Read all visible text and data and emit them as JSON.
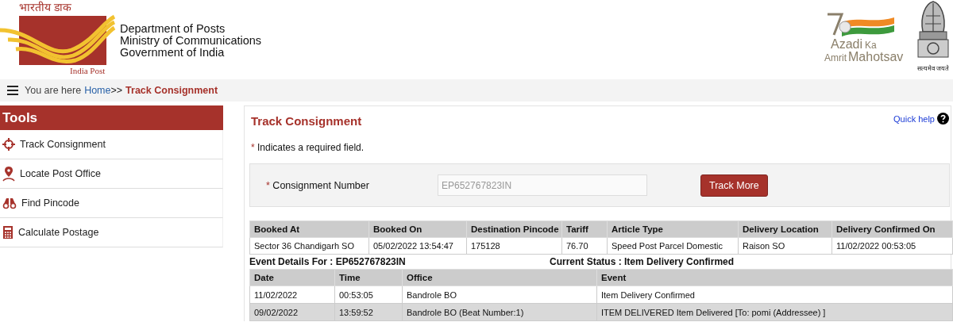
{
  "header": {
    "logo_hindi": "भारतीय डाक",
    "logo_caption": "India Post",
    "org_lines": [
      "Department of Posts",
      "Ministry of Communications",
      "Government of India"
    ],
    "azadi": [
      "Azadi",
      "Ka",
      "Amrit",
      "Mahotsav"
    ],
    "emblem_motto": "सत्यमेव जयते"
  },
  "breadcrumb": {
    "prefix": "You are here",
    "home": "Home",
    "separator": ">>",
    "current": "Track Consignment"
  },
  "sidebar": {
    "title": "Tools",
    "items": [
      {
        "label": "Track Consignment",
        "kind": "crosshair"
      },
      {
        "label": "Locate Post Office",
        "kind": "pin"
      },
      {
        "label": "Find Pincode",
        "kind": "binoculars"
      },
      {
        "label": "Calculate Postage",
        "kind": "calculator"
      }
    ]
  },
  "main": {
    "title": "Track Consignment",
    "quick_help": "Quick help",
    "required_note": "Indicates a required field.",
    "required_mark": "*",
    "form": {
      "label": "Consignment Number",
      "value": "EP652767823IN",
      "button": "Track More"
    },
    "summary": {
      "columns": [
        "Booked At",
        "Booked On",
        "Destination Pincode",
        "Tariff",
        "Article Type",
        "Delivery Location",
        "Delivery Confirmed On"
      ],
      "rows": [
        [
          "Sector 36 Chandigarh SO",
          "05/02/2022 13:54:47",
          "175128",
          "76.70",
          "Speed Post Parcel Domestic",
          "Raison SO",
          "11/02/2022 00:53:05"
        ]
      ]
    },
    "event_for": "Event Details For : EP652767823IN",
    "current_status": "Current Status : Item Delivery Confirmed",
    "events": {
      "columns": [
        "Date",
        "Time",
        "Office",
        "Event"
      ],
      "rows": [
        [
          "11/02/2022",
          "00:53:05",
          "Bandrole BO",
          "Item Delivery Confirmed"
        ],
        [
          "09/02/2022",
          "13:59:52",
          "Bandrole BO (Beat Number:1)",
          "ITEM DELIVERED Item Delivered [To: pomi (Addressee) ]"
        ]
      ]
    }
  }
}
